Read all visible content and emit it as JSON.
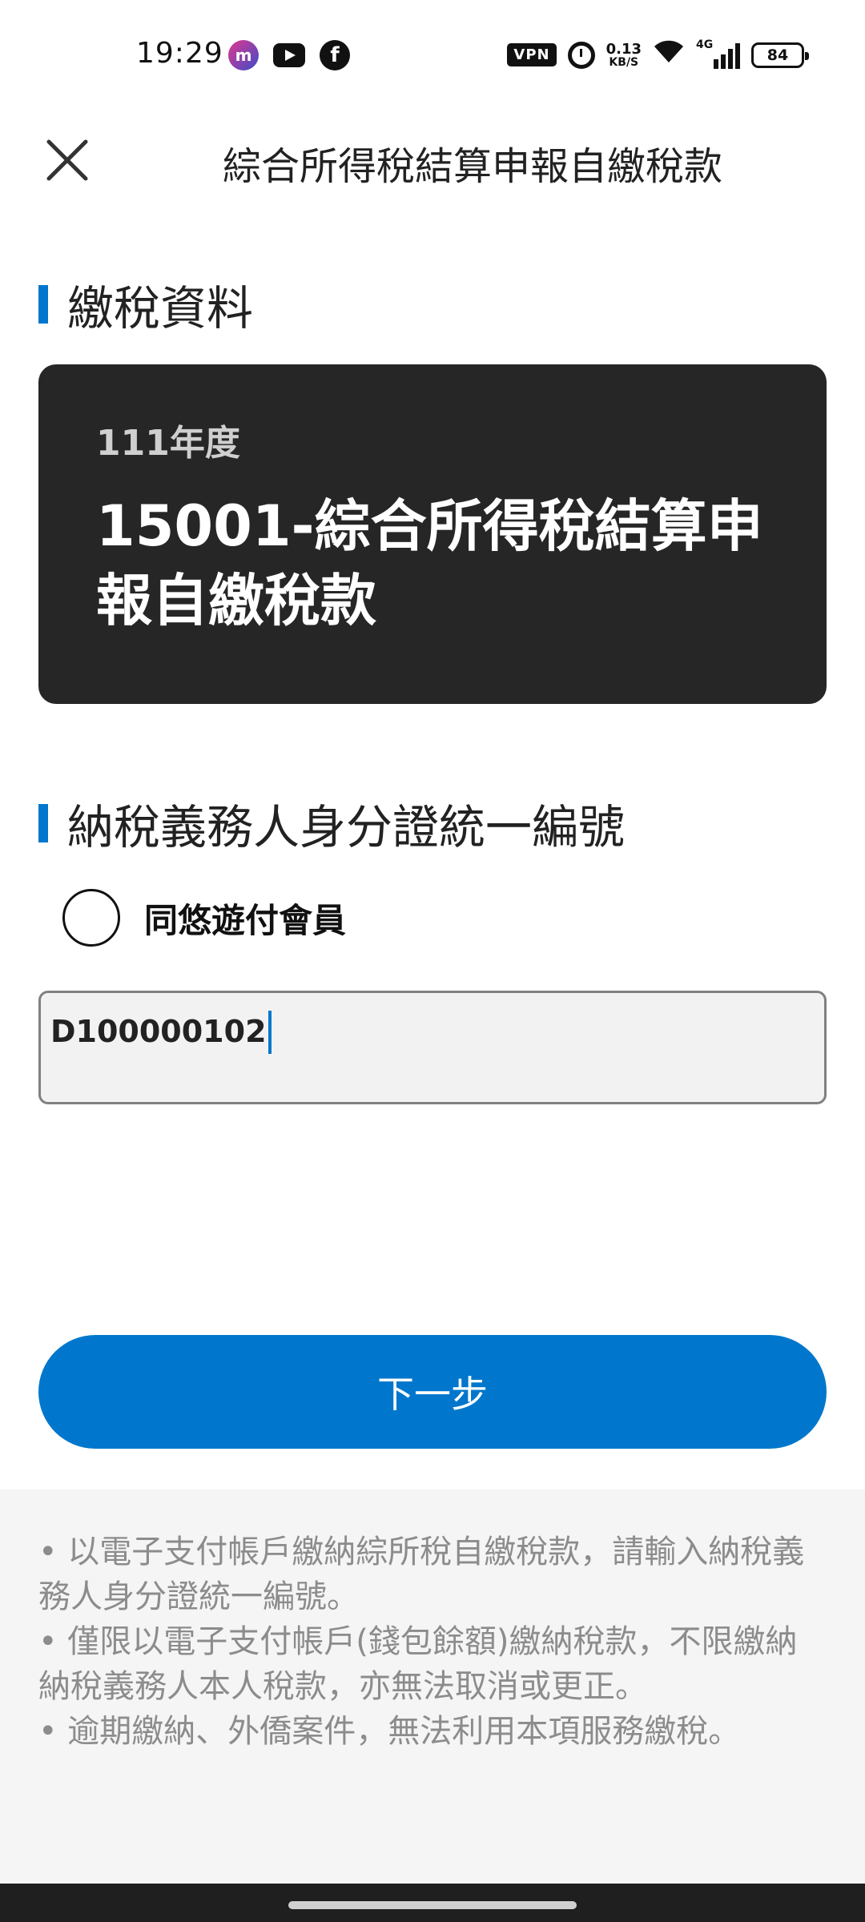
{
  "status_bar": {
    "time": "19:29",
    "vpn": "VPN",
    "net_speed_value": "0.13",
    "net_speed_unit": "KB/S",
    "network_type": "4G",
    "battery": "84",
    "app_icons": [
      "messenger-app-icon",
      "youtube-icon",
      "facebook-icon"
    ],
    "fb_glyph": "f"
  },
  "header": {
    "title": "綜合所得稅結算申報自繳稅款"
  },
  "tax_section": {
    "heading": "繳稅資料",
    "card": {
      "year": "111年度",
      "name": "15001-綜合所得稅結算申報自繳稅款"
    }
  },
  "id_section": {
    "heading": "納稅義務人身分證統一編號",
    "radio_label": "同悠遊付會員",
    "input_value": "D100000102"
  },
  "actions": {
    "next_label": "下一步"
  },
  "notes": [
    "• 以電子支付帳戶繳納綜所稅自繳稅款，請輸入納稅義務人身分證統一編號。",
    "• 僅限以電子支付帳戶(錢包餘額)繳納稅款，不限繳納納稅義務人本人稅款，亦無法取消或更正。",
    "• 逾期繳納、外僑案件，無法利用本項服務繳稅。"
  ],
  "colors": {
    "accent": "#0077cc",
    "card_bg": "#262626",
    "notes_bg": "#f5f5f5"
  }
}
